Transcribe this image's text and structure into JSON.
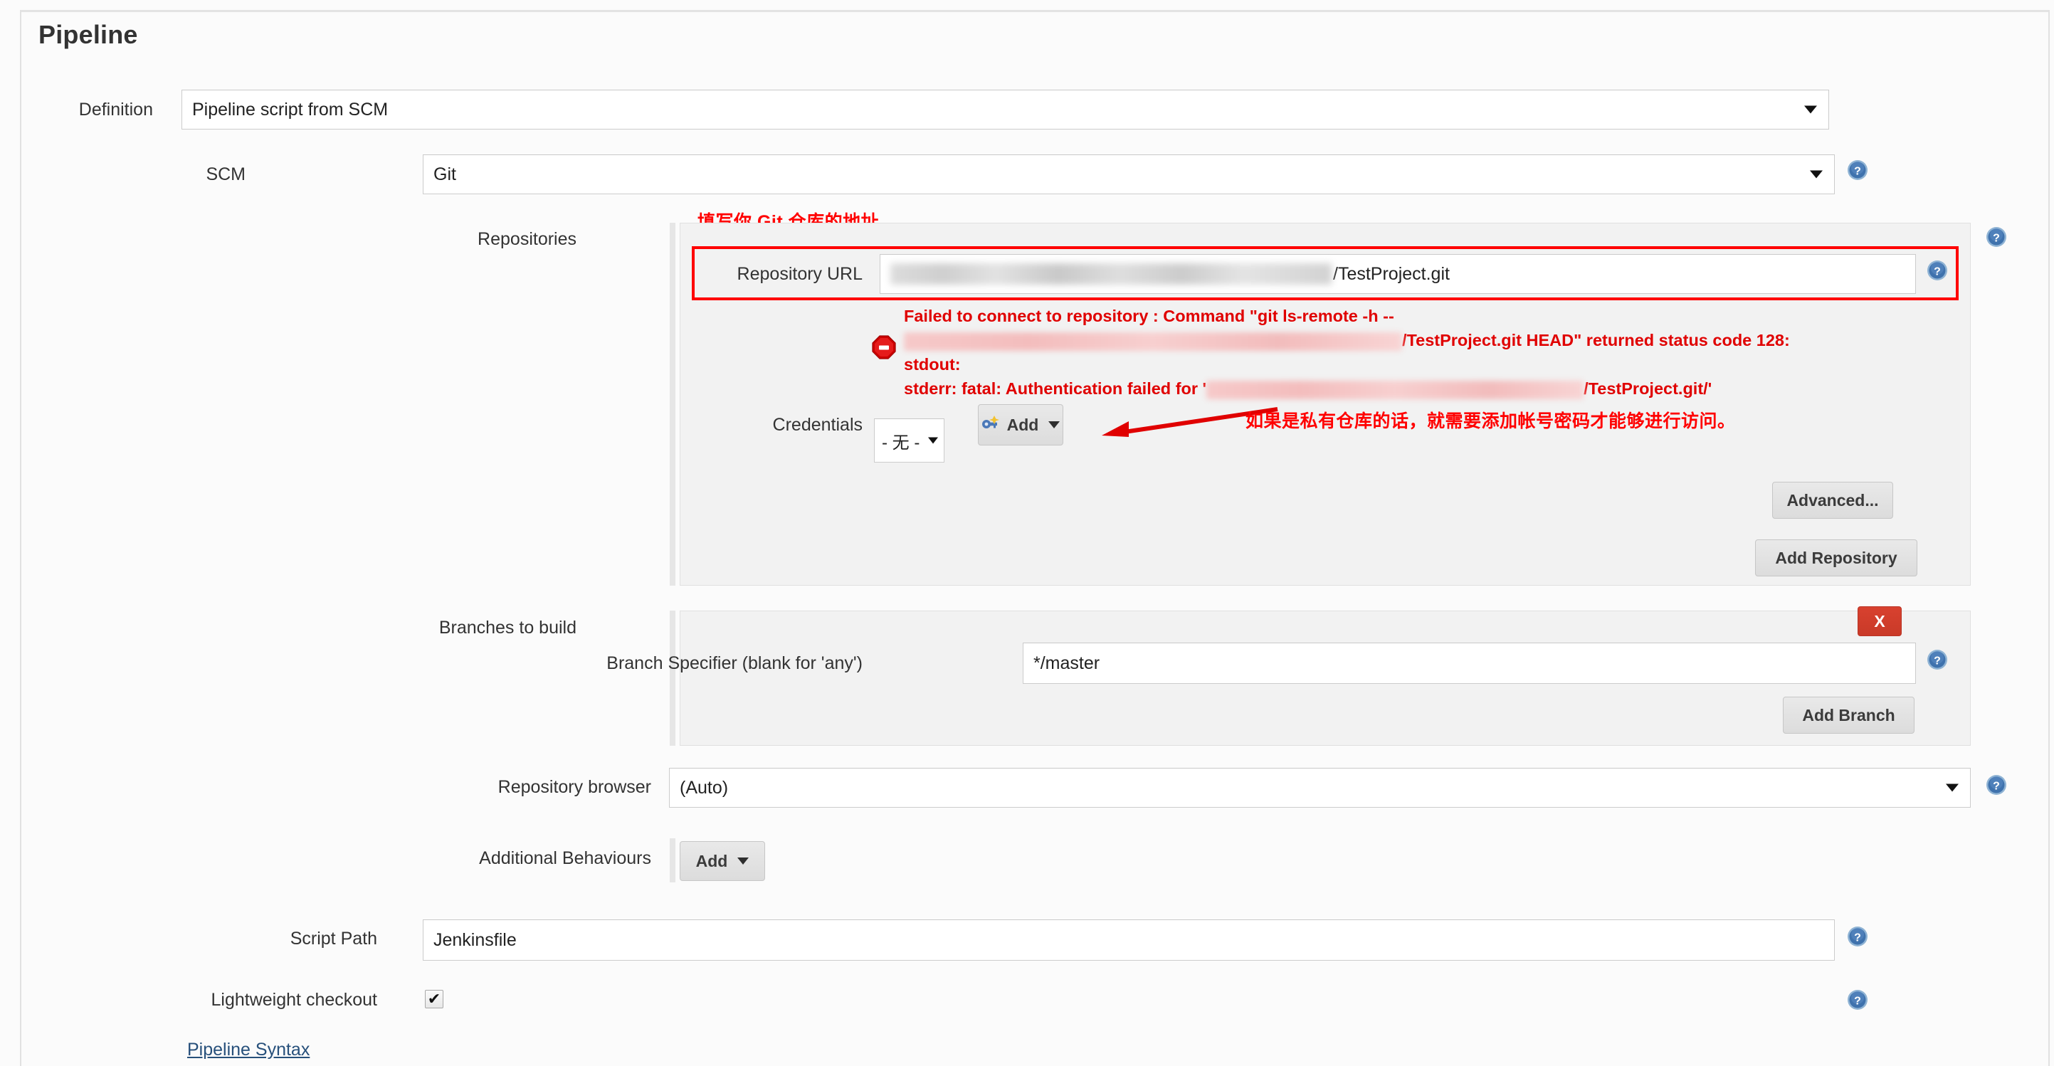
{
  "page": {
    "title": "Pipeline"
  },
  "definition": {
    "label": "Definition",
    "value": "Pipeline script from SCM"
  },
  "scm": {
    "label": "SCM",
    "value": "Git"
  },
  "repositories": {
    "label": "Repositories",
    "url_label": "Repository URL",
    "url_value": "/TestProject.git",
    "credentials_label": "Credentials",
    "credentials_value": "- 无 -",
    "add_button": "Add",
    "advanced_button": "Advanced...",
    "add_repository_button": "Add Repository",
    "error": {
      "line1": "Failed to connect to repository : Command \"git ls-remote -h --",
      "line2_suffix": "/TestProject.git HEAD\" returned status code 128:",
      "line3": "stdout:",
      "line4_prefix": "stderr: fatal: Authentication failed for '",
      "line4_suffix": "/TestProject.git/'"
    }
  },
  "branches": {
    "label": "Branches to build",
    "specifier_label": "Branch Specifier (blank for 'any')",
    "specifier_value": "*/master",
    "delete_button": "X",
    "add_branch_button": "Add Branch"
  },
  "repository_browser": {
    "label": "Repository browser",
    "value": "(Auto)"
  },
  "additional_behaviours": {
    "label": "Additional Behaviours",
    "add_button": "Add"
  },
  "script_path": {
    "label": "Script Path",
    "value": "Jenkinsfile"
  },
  "lightweight_checkout": {
    "label": "Lightweight checkout",
    "checked_glyph": "✔"
  },
  "pipeline_syntax": {
    "label": "Pipeline Syntax"
  },
  "annotations": {
    "repo_url_note": "填写你 Git 仓库的地址。",
    "credentials_note": "如果是私有仓库的话，就需要添加帐号密码才能够进行访问。"
  },
  "colors": {
    "annotation_red": "#ff0000",
    "error_red": "#e00000",
    "delete_button_red": "#d8412f",
    "help_blue": "#3f72ad",
    "link_blue": "#27507b"
  },
  "icons": {
    "help": "help-icon",
    "error": "error-stop-icon",
    "key": "key-icon"
  }
}
